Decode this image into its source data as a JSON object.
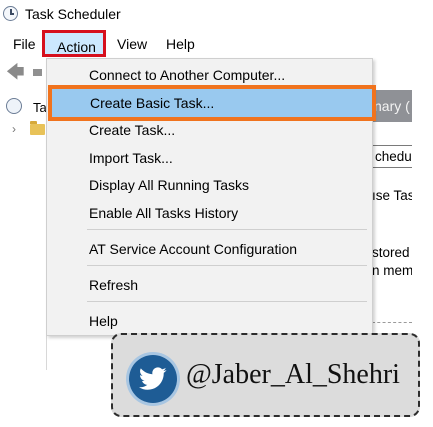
{
  "window": {
    "title": "Task Scheduler"
  },
  "menubar": {
    "file": "File",
    "action": "Action",
    "view": "View",
    "help": "Help"
  },
  "left_tree": {
    "root_label": "Ta"
  },
  "action_menu": {
    "items": {
      "connect": "Connect to Another Computer...",
      "create_basic": "Create Basic Task...",
      "create_task": "Create Task...",
      "import_task": "Import Task...",
      "display_running": "Display All Running Tasks",
      "enable_history": "Enable All Tasks History",
      "at_service": "AT Service Account Configuration",
      "refresh": "Refresh",
      "help": "Help"
    },
    "highlighted": "Create Basic Task..."
  },
  "right_pane": {
    "header": "nary (",
    "tab": "chedu",
    "line1": "ıse Tas",
    "line2": "stored",
    "line3": "n mem"
  },
  "watermark": {
    "handle": "@Jaber_Al_Shehri",
    "icon": "twitter-bird-icon"
  },
  "colors": {
    "menu_highlight": "#99c9ef",
    "highlight_border": "#f0731e",
    "action_border": "#d6101e"
  }
}
